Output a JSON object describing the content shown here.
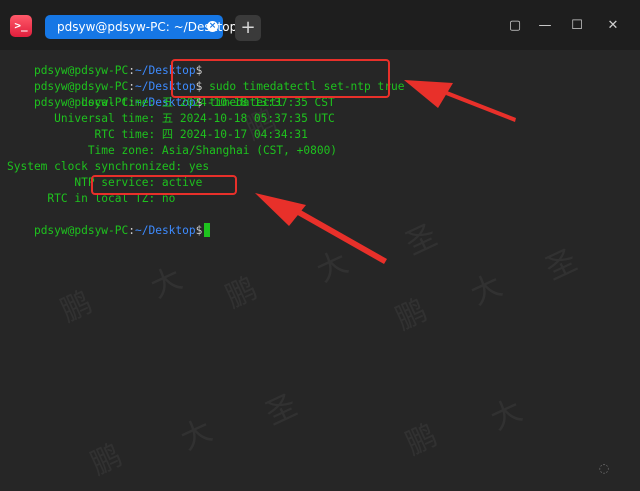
{
  "window": {
    "tab_title": "pdsyw@pdsyw-PC: ~/Desktop",
    "new_tab_label": "+",
    "app_icon_glyph": ">_",
    "tab_close_glyph": "×",
    "minimize_glyph": "—",
    "maximize_glyph": "☐",
    "restore_glyph": "▢",
    "close_glyph": "✕",
    "colors": {
      "tab_active": "#1677e5",
      "prompt_green": "#1ec21e",
      "path_blue": "#3d8bff",
      "annotation_red": "#e8302a",
      "terminal_bg": "#262626"
    }
  },
  "terminal": {
    "prompt_user": "pdsyw@pdsyw-PC",
    "prompt_sep": ":",
    "prompt_path": "~/Desktop",
    "prompt_dollar": "$",
    "commands": [
      "",
      " sudo timedatectl set-ntp true",
      " timedatectl",
      ""
    ],
    "output": [
      "           Local time: 五 2024-10-18 13:37:35 CST",
      "       Universal time: 五 2024-10-18 05:37:35 UTC",
      "             RTC time: 四 2024-10-17 04:34:31",
      "            Time zone: Asia/Shanghai (CST, +0800)",
      "System clock synchronized: yes",
      "          NTP service: active",
      "      RTC in local TZ: no"
    ]
  },
  "watermark": {
    "chars": [
      "鹏",
      "大",
      "圣"
    ]
  }
}
